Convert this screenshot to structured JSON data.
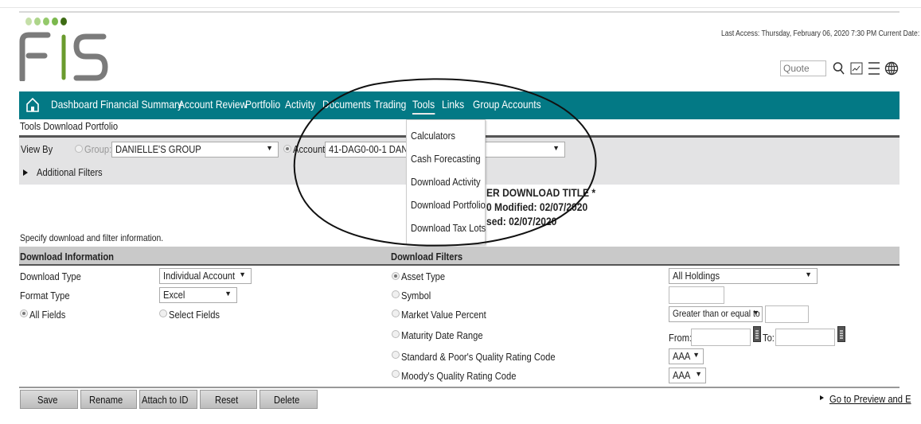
{
  "brand": {
    "name": "FIS",
    "dot_colors": [
      "#c5dfa8",
      "#add58a",
      "#94c96a",
      "#7bb84d",
      "#3d6b14"
    ],
    "letter_color": "#7b7b7b",
    "accent_color": "#6a9b2d"
  },
  "header": {
    "last_access": "Last Access: Thursday, February 06, 2020 7:30 PM Current Date: Fri",
    "quote_placeholder": "Quote",
    "icons": [
      "search-icon",
      "chart-icon",
      "menu-icon",
      "globe-icon"
    ]
  },
  "nav": {
    "color": "#037985",
    "items": [
      {
        "label": "Dashboard"
      },
      {
        "label": "Financial Summary"
      },
      {
        "label": "Account Review"
      },
      {
        "label": "Portfolio"
      },
      {
        "label": "Activity"
      },
      {
        "label": "Documents"
      },
      {
        "label": "Trading"
      },
      {
        "label": "Tools",
        "active": true
      },
      {
        "label": "Links"
      },
      {
        "label": "Group Accounts"
      }
    ]
  },
  "tools_menu": {
    "items": [
      "Calculators",
      "Cash Forecasting",
      "Download Activity",
      "Download Portfolio",
      "Download Tax Lots"
    ]
  },
  "page": {
    "title": "Tools Download Portfolio",
    "view_by_label": "View By",
    "group_label": "Group:",
    "group_value": "DANIELLE'S GROUP",
    "account_label": "Account:",
    "account_value": "41-DAG0-00-1 DANIEL",
    "additional_filters": "Additional Filters",
    "download_title_lines": [
      "ER DOWNLOAD TITLE *",
      "0 Modified: 02/07/2020",
      "sed: 02/07/2020"
    ],
    "specify_text": "Specify download and filter information."
  },
  "download_info": {
    "heading": "Download Information",
    "download_type_label": "Download Type",
    "download_type_value": "Individual Account",
    "format_type_label": "Format Type",
    "format_type_value": "Excel",
    "all_fields_label": "All Fields",
    "select_fields_label": "Select Fields"
  },
  "download_filters": {
    "heading": "Download Filters",
    "asset_type_label": "Asset Type",
    "asset_type_value": "All Holdings",
    "symbol_label": "Symbol",
    "symbol_value": "",
    "market_value_label": "Market Value Percent",
    "market_value_operator": "Greater than or equal to",
    "market_value_value": "",
    "maturity_label": "Maturity Date Range",
    "from_label": "From:",
    "to_label": "To:",
    "sp_label": "Standard & Poor's Quality Rating Code",
    "sp_value": "AAA",
    "moody_label": "Moody's Quality Rating Code",
    "moody_value": "AAA"
  },
  "buttons": {
    "save": "Save",
    "rename": "Rename",
    "attach": "Attach to ID",
    "reset": "Reset",
    "delete": "Delete",
    "go_preview": "Go to Preview and E"
  }
}
